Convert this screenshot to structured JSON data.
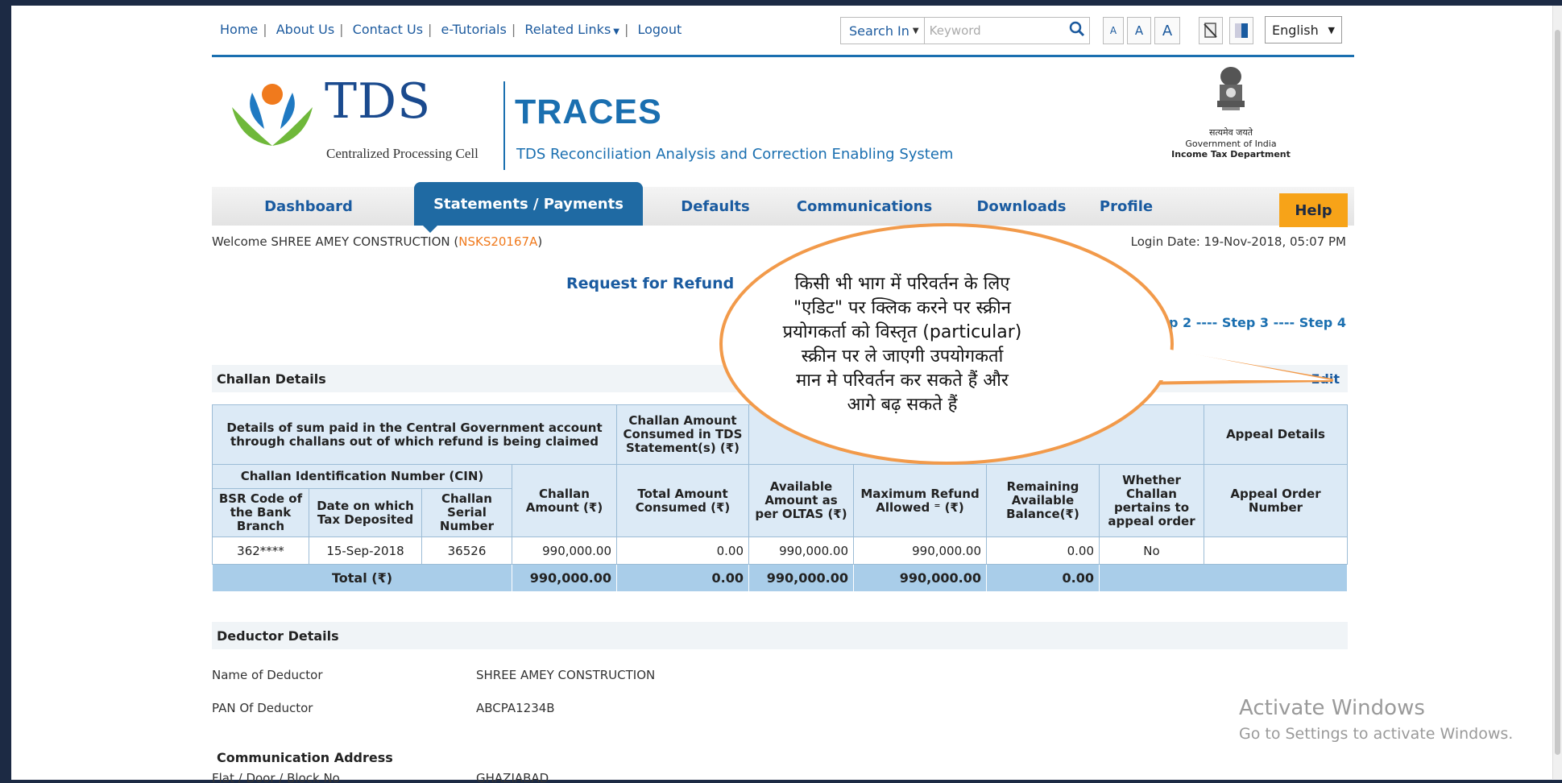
{
  "toplinks": {
    "home": "Home",
    "about": "About Us",
    "contact": "Contact Us",
    "tutorials": "e-Tutorials",
    "related": "Related Links",
    "logout": "Logout"
  },
  "search": {
    "select_label": "Search In",
    "placeholder": "Keyword"
  },
  "font_buttons": [
    "A",
    "A",
    "A"
  ],
  "language": "English",
  "brand": {
    "tds": "TDS",
    "cpc": "Centralized Processing Cell",
    "traces": "TRACES",
    "traces_full": "TDS Reconciliation Analysis and Correction Enabling System",
    "emblem_motto": "सत्यमेव जयते",
    "gov": "Government of India",
    "dept": "Income Tax Department"
  },
  "nav": {
    "items": [
      "Dashboard",
      "Statements / Payments",
      "Defaults",
      "Communications",
      "Downloads",
      "Profile"
    ],
    "help": "Help",
    "active": "Statements / Payments"
  },
  "welcome": {
    "prefix": "Welcome SHREE AMEY CONSTRUCTION (",
    "pan": "NSKS20167A",
    "suffix": ")"
  },
  "login_date": "Login Date: 19-Nov-2018, 05:07 PM",
  "request_title": "Request for Refund",
  "steps": "Step 2 ---- Step 3 ---- Step 4",
  "challan": {
    "section": "Challan Details",
    "edit": "Edit",
    "head": {
      "details": "Details of sum paid in the Central Government account through challans out of which refund is being claimed",
      "consumed": "Challan Amount Consumed in TDS Statement(s) (₹)",
      "appeal": "Appeal Details",
      "cin": "Challan Identification Number (CIN)",
      "bsr": "BSR Code of the Bank Branch",
      "date": "Date on which Tax Deposited",
      "serial": "Challan Serial Number",
      "amount": "Challan Amount (₹)",
      "total_consumed": "Total Amount Consumed (₹)",
      "available": "Available Amount as per OLTAS (₹)",
      "max_refund": "Maximum Refund Allowed ⁼ (₹)",
      "remaining": "Remaining Available Balance(₹)",
      "whether": "Whether Challan pertains to appeal order",
      "appeal_no": "Appeal Order Number"
    },
    "row": {
      "bsr": "362****",
      "date": "15-Sep-2018",
      "serial": "36526",
      "amount": "990,000.00",
      "consumed": "0.00",
      "available": "990,000.00",
      "max_refund": "990,000.00",
      "remaining": "0.00",
      "whether": "No",
      "appeal_no": ""
    },
    "total": {
      "label": "Total (₹)",
      "amount": "990,000.00",
      "consumed": "0.00",
      "available": "990,000.00",
      "max_refund": "990,000.00",
      "remaining": "0.00"
    }
  },
  "deductor": {
    "section": "Deductor Details",
    "name_label": "Name of Deductor",
    "name_value": "SHREE AMEY CONSTRUCTION",
    "pan_label": "PAN Of Deductor",
    "pan_value": "ABCPA1234B"
  },
  "address": {
    "section": "Communication Address",
    "flat_label": "Flat / Door / Block No",
    "flat_value": "GHAZIABAD"
  },
  "callout": {
    "lines": [
      "किसी भी भाग में परिवर्तन के लिए",
      "\"एडिट\" पर क्लिक करने पर स्क्रीन",
      "प्रयोगकर्ता को विस्तृत (particular)",
      "स्क्रीन पर ले जाएगी उपयोगकर्ता",
      "मान मे परिवर्तन कर सकते हैं और",
      "आगे बढ़ सकते हैं"
    ]
  },
  "watermark": {
    "title": "Activate Windows",
    "sub": "Go to Settings to activate Windows."
  },
  "colors": {
    "brand_blue": "#1a6fb0",
    "active_tab": "#1f6aa3",
    "help": "#f7a318",
    "callout_border": "#f29a4a"
  }
}
